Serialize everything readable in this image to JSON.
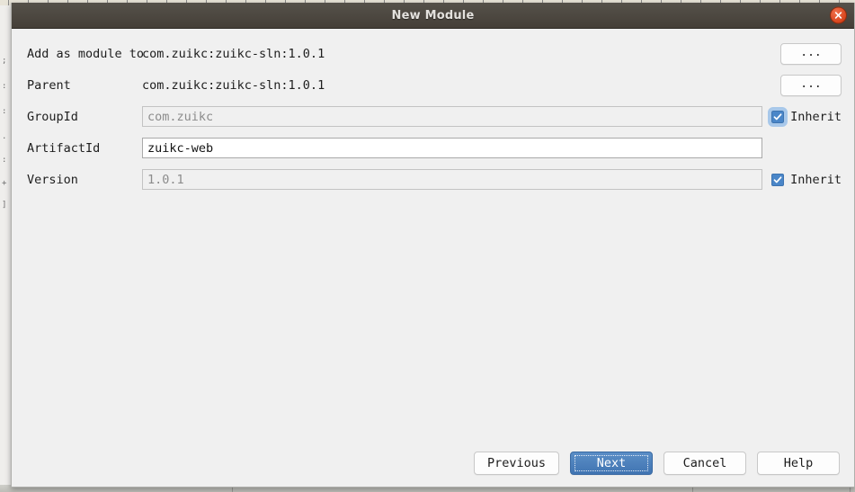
{
  "window": {
    "title": "New Module",
    "close_icon": "close-icon",
    "accent_blue": "#4a86c8",
    "default_button_blue": "#4074b2",
    "titlebar_color": "#4b463f",
    "close_button_color": "#d7441c",
    "dialog_background": "#f0f0f0"
  },
  "form": {
    "rows": [
      {
        "label": "Add as module to",
        "value": "com.zuikc:zuikc-sln:1.0.1",
        "kind": "static",
        "trailing": "dots"
      },
      {
        "label": "Parent",
        "value": "com.zuikc:zuikc-sln:1.0.1",
        "kind": "static",
        "trailing": "dots"
      },
      {
        "label": "GroupId",
        "value": "com.zuikc",
        "kind": "input",
        "enabled": false,
        "trailing": "checkbox"
      },
      {
        "label": "ArtifactId",
        "value": "zuikc-web",
        "kind": "input",
        "enabled": true,
        "trailing": "none"
      },
      {
        "label": "Version",
        "value": "1.0.1",
        "kind": "input",
        "enabled": false,
        "trailing": "checkbox"
      }
    ],
    "dots_button_label": "...",
    "inherit_label": "Inherit",
    "groupid_inherit_checked": true,
    "groupid_inherit_focused": true,
    "version_inherit_checked": true,
    "version_inherit_focused": false
  },
  "footer": {
    "previous_label": "Previous",
    "next_label": "Next",
    "cancel_label": "Cancel",
    "help_label": "Help",
    "default_button": "Next"
  },
  "background": {
    "left_fragments": [
      ";",
      ":",
      ":",
      ".",
      ":",
      "+",
      "]"
    ]
  }
}
